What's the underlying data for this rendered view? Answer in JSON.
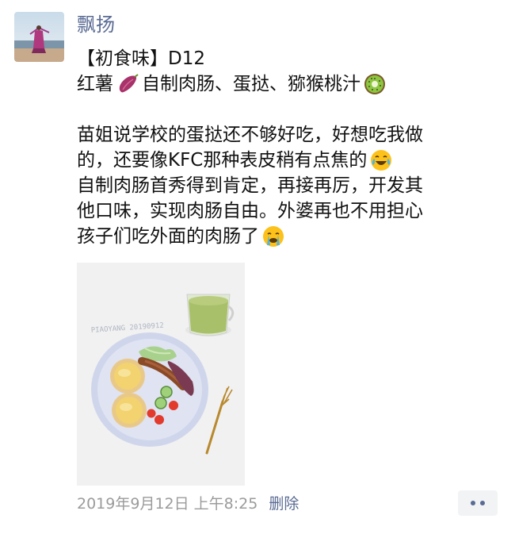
{
  "post": {
    "author": "飘扬",
    "line1": "【初食味】D12",
    "line2_a": "红薯",
    "line2_b": "自制肉肠、蛋挞、猕猴桃汁",
    "p1_l1": "苗姐说学校的蛋挞还不够好吃，好想吃我做",
    "p1_l2": "的，还要像KFC那种表皮稍有点焦的",
    "p2_l1": "自制肉肠首秀得到肯定，再接再厉，开发其",
    "p2_l2": "他口味，实现肉肠自由。外婆再也不用担心",
    "p2_l3": "孩子们吃外面的肉肠了",
    "photo_watermark": "PIAOYANG 20190912",
    "timestamp": "2019年9月12日 上午8:25",
    "delete_label": "删除"
  },
  "icons": {
    "sweet_potato": "sweet-potato-emoji",
    "kiwi": "kiwi-emoji",
    "laughing": "tears-of-joy-emoji",
    "crying": "loudly-crying-emoji",
    "more": "more-dots-icon"
  },
  "colors": {
    "link": "#5a6b94",
    "muted": "#9b9b9b",
    "button_bg": "#f2f3f5"
  }
}
